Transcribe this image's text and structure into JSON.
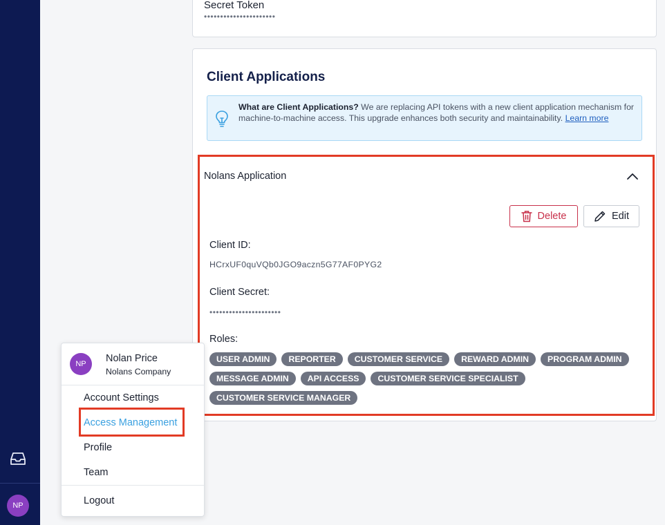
{
  "rail": {
    "inbox_icon": "inbox-tray-icon",
    "avatar_initials": "NP"
  },
  "token_card": {
    "label": "Secret Token",
    "masked_value": "••••••••••••••••••••••"
  },
  "client_apps": {
    "title": "Client Applications",
    "info": {
      "icon": "lightbulb-icon",
      "bold_lead": "What are Client Applications?",
      "body": " We are replacing API tokens with a new client application mechanism for machine-to-machine access. This upgrade enhances both security and maintainability. ",
      "link_text": "Learn more"
    },
    "app": {
      "name": "Nolans Application",
      "delete_label": "Delete",
      "edit_label": "Edit",
      "client_id_label": "Client ID:",
      "client_id_value": "HCrxUF0quVQb0JGO9aczn5G77AF0PYG2",
      "client_secret_label": "Client Secret:",
      "client_secret_value": "••••••••••••••••••••••",
      "roles_label": "Roles:",
      "roles": [
        "USER ADMIN",
        "REPORTER",
        "CUSTOMER SERVICE",
        "REWARD ADMIN",
        "PROGRAM ADMIN",
        "MESSAGE ADMIN",
        "API ACCESS",
        "CUSTOMER SERVICE SPECIALIST",
        "CUSTOMER SERVICE MANAGER"
      ]
    }
  },
  "user_menu": {
    "avatar_initials": "NP",
    "user_name": "Nolan Price",
    "company": "Nolans Company",
    "items": {
      "account_settings": "Account Settings",
      "access_management": "Access Management",
      "profile": "Profile",
      "team": "Team",
      "logout": "Logout"
    }
  },
  "colors": {
    "rail": "#0d1a52",
    "highlight": "#e23b25",
    "active_link": "#3aa0e0",
    "delete": "#c8304a",
    "role_badge": "#6e7381"
  }
}
